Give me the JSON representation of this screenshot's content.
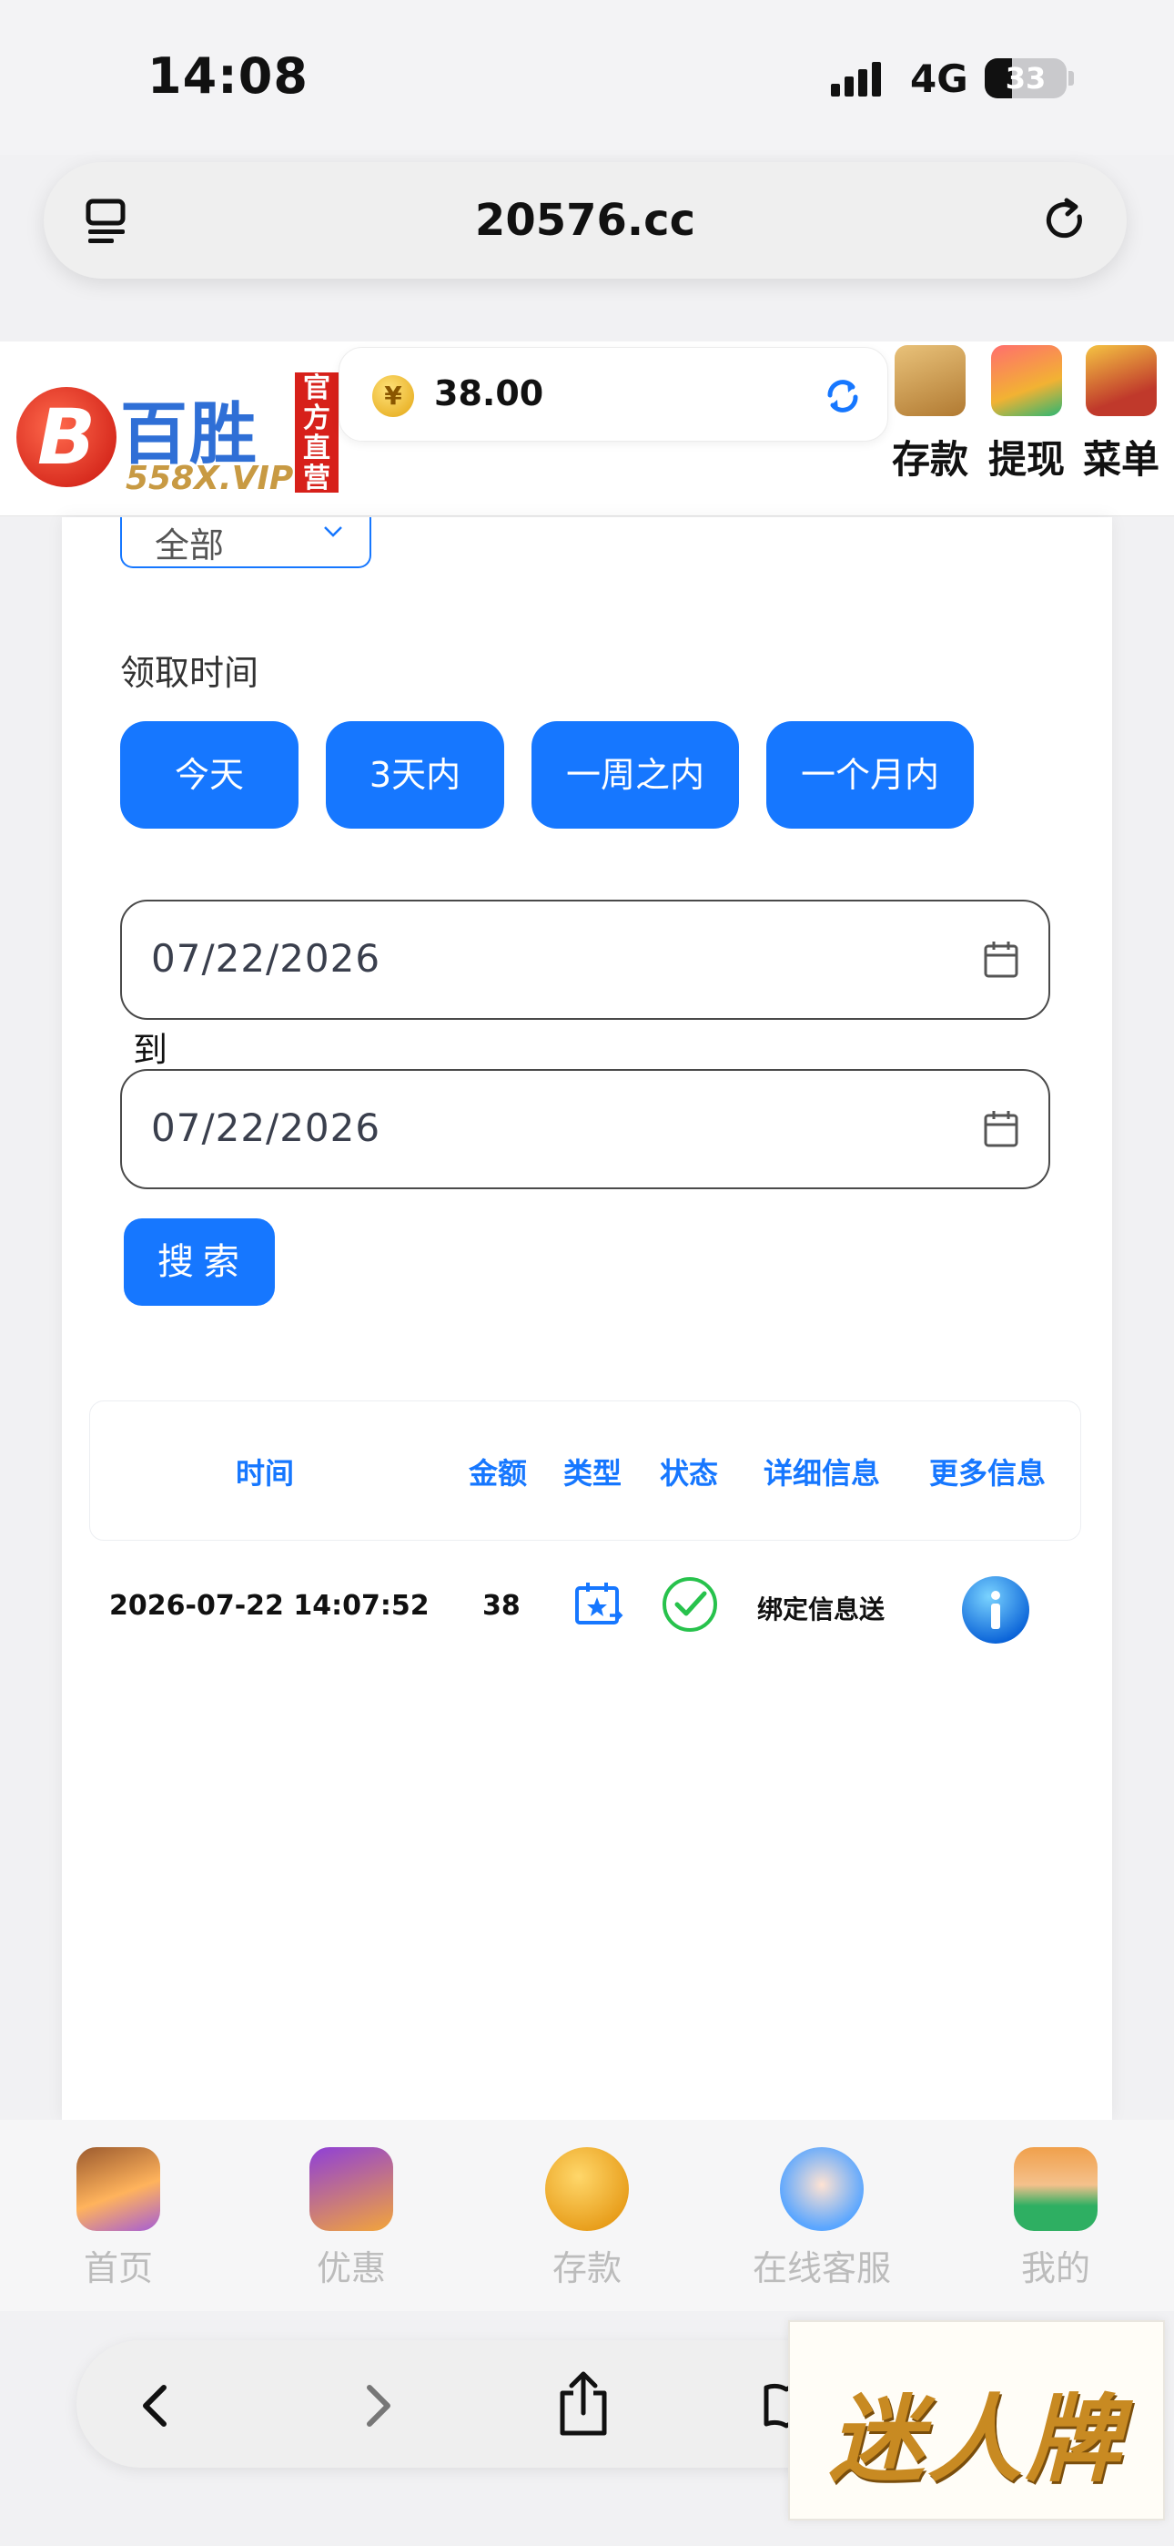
{
  "status_bar": {
    "time": "14:08",
    "network": "4G",
    "battery": "33"
  },
  "browser": {
    "url": "20576.cc"
  },
  "header": {
    "logo": {
      "brand": "百胜",
      "domain": "558X.VIP",
      "badge": "官方直营"
    },
    "balance": {
      "amount": "38.00"
    },
    "actions": [
      {
        "label": "存款",
        "icon": "wallet-deposit-icon"
      },
      {
        "label": "提现",
        "icon": "withdraw-icon"
      },
      {
        "label": "菜单",
        "icon": "treasure-chest-icon"
      }
    ]
  },
  "filter": {
    "type_select": {
      "value": "全部"
    },
    "time_label": "领取时间",
    "quick_ranges": [
      "今天",
      "3天内",
      "一周之内",
      "一个月内"
    ],
    "start_date": "07/22/2026",
    "to_label": "到",
    "end_date": "07/22/2026",
    "search_label": "搜索"
  },
  "table": {
    "columns": [
      "时间",
      "金额",
      "类型",
      "状态",
      "详细信息",
      "更多信息"
    ],
    "rows": [
      {
        "time": "2026-07-22 14:07:52",
        "amount": "38",
        "type_icon": "gift-card-icon",
        "status_icon": "check-circle-icon",
        "detail": "绑定信息送",
        "more_icon": "info-icon"
      }
    ]
  },
  "tab_bar": {
    "items": [
      {
        "label": "首页",
        "icon": "home-icon"
      },
      {
        "label": "优惠",
        "icon": "gift-icon"
      },
      {
        "label": "存款",
        "icon": "deposit-coin-icon"
      },
      {
        "label": "在线客服",
        "icon": "support-agent-icon"
      },
      {
        "label": "我的",
        "icon": "user-icon"
      }
    ]
  },
  "watermark": "迷人牌",
  "colors": {
    "accent": "#1677ff",
    "tab_inactive": "#bcbcbc",
    "status_ok": "#27c24c"
  }
}
